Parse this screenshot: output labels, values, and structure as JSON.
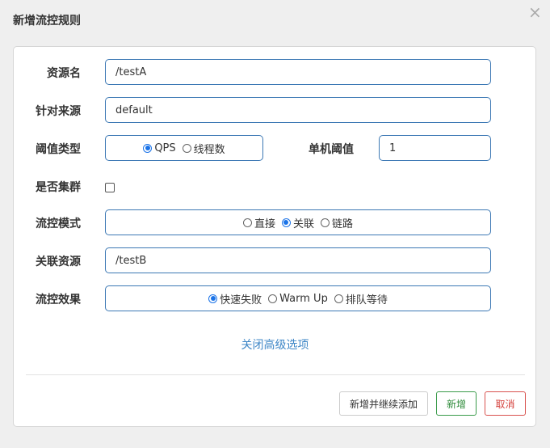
{
  "dialog": {
    "title": "新增流控规则",
    "close_glyph": "×"
  },
  "form": {
    "resource_label": "资源名",
    "resource_value": "/testA",
    "source_label": "针对来源",
    "source_value": "default",
    "threshold_type_label": "阈值类型",
    "threshold_type_options": [
      {
        "label": "QPS",
        "selected": true
      },
      {
        "label": "线程数",
        "selected": false
      }
    ],
    "single_threshold_label": "单机阈值",
    "single_threshold_value": "1",
    "cluster_label": "是否集群",
    "cluster_checked": false,
    "mode_label": "流控模式",
    "mode_options": [
      {
        "label": "直接",
        "selected": false
      },
      {
        "label": "关联",
        "selected": true
      },
      {
        "label": "链路",
        "selected": false
      }
    ],
    "related_resource_label": "关联资源",
    "related_resource_value": "/testB",
    "effect_label": "流控效果",
    "effect_options": [
      {
        "label": "快速失败",
        "selected": true
      },
      {
        "label": "Warm Up",
        "selected": false
      },
      {
        "label": "排队等待",
        "selected": false
      }
    ],
    "advanced_toggle": "关闭高级选项"
  },
  "footer": {
    "add_continue_label": "新增并继续添加",
    "add_label": "新增",
    "cancel_label": "取消"
  },
  "colors": {
    "accent": "#3c78b4",
    "link": "#3f87c7",
    "success": "#2e8b3a",
    "danger": "#d43f3a"
  }
}
